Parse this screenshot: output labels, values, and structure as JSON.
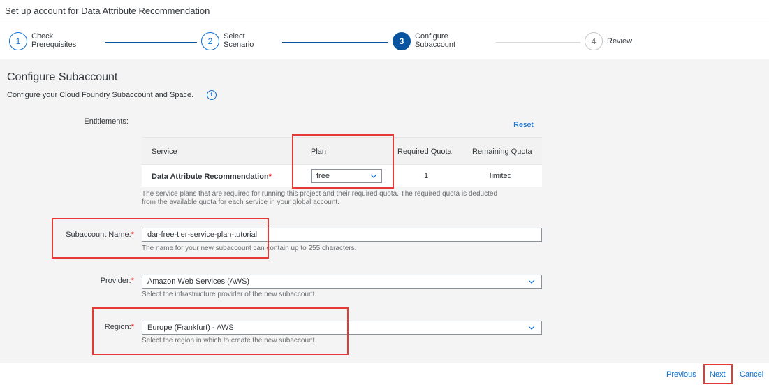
{
  "window": {
    "title": "Set up account for Data Attribute Recommendation"
  },
  "wizard": {
    "steps": [
      {
        "number": "1",
        "line1": "Check",
        "line2": "Prerequisites",
        "state": "done"
      },
      {
        "number": "2",
        "line1": "Select",
        "line2": "Scenario",
        "state": "done"
      },
      {
        "number": "3",
        "line1": "Configure",
        "line2": "Subaccount",
        "state": "active"
      },
      {
        "number": "4",
        "line1": "Review",
        "line2": "",
        "state": "inactive"
      }
    ]
  },
  "section": {
    "title": "Configure Subaccount",
    "subtitle": "Configure your Cloud Foundry Subaccount and Space.",
    "info_icon": "info-icon"
  },
  "entitlements": {
    "label": "Entitlements:",
    "reset": "Reset",
    "columns": [
      "Service",
      "Plan",
      "Required Quota",
      "Remaining Quota"
    ],
    "rows": [
      {
        "service": "Data Attribute Recommendation",
        "required_marker": "*",
        "plan": "free",
        "required_quota": "1",
        "remaining_quota": "limited"
      }
    ],
    "help_line1": "The service plans that are required for running this project and their required quota. The required quota is deducted",
    "help_line2": "from the available quota for each service in your global account."
  },
  "subaccount": {
    "label": "Subaccount Name:",
    "required_marker": "*",
    "value": "dar-free-tier-service-plan-tutorial",
    "help": "The name for your new subaccount can contain up to 255 characters."
  },
  "provider": {
    "label": "Provider:",
    "required_marker": "*",
    "value": "Amazon Web Services (AWS)",
    "help": "Select the infrastructure provider of the new subaccount."
  },
  "region": {
    "label": "Region:",
    "required_marker": "*",
    "value": "Europe (Frankfurt) - AWS",
    "help": "Select the region in which to create the new subaccount."
  },
  "footer": {
    "previous": "Previous",
    "next": "Next",
    "cancel": "Cancel"
  },
  "colors": {
    "accent": "#0a6ed1",
    "active_step": "#0854a0",
    "highlight": "#e53935",
    "required": "#e00000"
  }
}
